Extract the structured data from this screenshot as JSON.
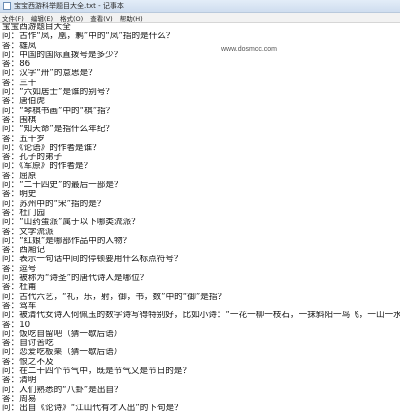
{
  "window": {
    "title": "宝宝西游科举题目大全.txt - 记事本"
  },
  "menu": [
    "文件(F)",
    "编辑(E)",
    "格式(O)",
    "查看(V)",
    "帮助(H)"
  ],
  "watermark": "www.dosmcc.com",
  "lines": [
    "宝宝西游题目大全",
    "问：古作“凤，凰，鹣”中的“凤”指的是什么？",
    "答：雄凤",
    "问：中国的国际直拨号是多少？",
    "答：86",
    "问：汉字“卅”的意思是？",
    "答：三十",
    "问：“六如居士”是谁的别号？",
    "答：唐伯虎",
    "问：“琴棋书画”中的“棋”指？",
    "答：围棋",
    "问：“知天命”是指什么年纪？",
    "答：五十岁",
    "问：《论语》的作者是谁？",
    "答：孔子的弟子",
    "问：《军原》的作者是？",
    "答：屈原",
    "问：“二十四史”的最后一部是？",
    "答：明史",
    "问：苏州中的“宋”指的是？",
    "答：杜门园",
    "问：“山药蛋派”属于以下哪类流派？",
    "答：文学流派",
    "问：“红娘”是哪部作品中的人物？",
    "答：西厢记",
    "问：表示一句话中间的停顿要用什么标点符号？",
    "答：逗号",
    "问：被称为“诗圣”的唐代诗人是哪位？",
    "答：杜甫",
    "问：古代六艺，“礼，乐，射，御，书，数”中的“御”是指？",
    "答：驾车",
    "问：被清代女诗人何佩玉的数字诗写得特别好，比如小诗：“一花一柳一枝石，一抹斜阳一鸟飞，一山一水",
    "答：10",
    "问：饭吃自留吧（猜一歇后语）",
    "答：自讨苦吃",
    "问：恋爱吃板栗（猜一歇后语）",
    "答：恨之不及",
    "问：在二十四个节气中，既是节气又是节日的是？",
    "答：清明",
    "问：人们熟悉的“八卦”是出自？",
    "答：周易",
    "问：出自《论诗》“江山代有才人出”的下句是？"
  ]
}
